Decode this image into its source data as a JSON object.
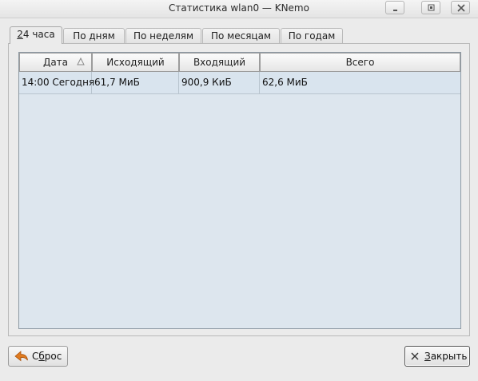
{
  "window": {
    "title": "Статистика wlan0 — KNemo"
  },
  "tabs": [
    {
      "label_prefix": "2",
      "label_rest": "4 часа",
      "active": true
    },
    {
      "label": "По дням"
    },
    {
      "label": "По неделям"
    },
    {
      "label": "По месяцам"
    },
    {
      "label": "По годам"
    }
  ],
  "table": {
    "columns": [
      "Дата",
      "Исходящий",
      "Входящий",
      "Всего"
    ],
    "rows": [
      [
        "14:00 Сегодня",
        "61,7 МиБ",
        "900,9 КиБ",
        "62,6 МиБ"
      ]
    ]
  },
  "buttons": {
    "reset_prefix": "С",
    "reset_mid": "б",
    "reset_rest": "рос",
    "close_prefix": "З",
    "close_rest": "акрыть"
  }
}
